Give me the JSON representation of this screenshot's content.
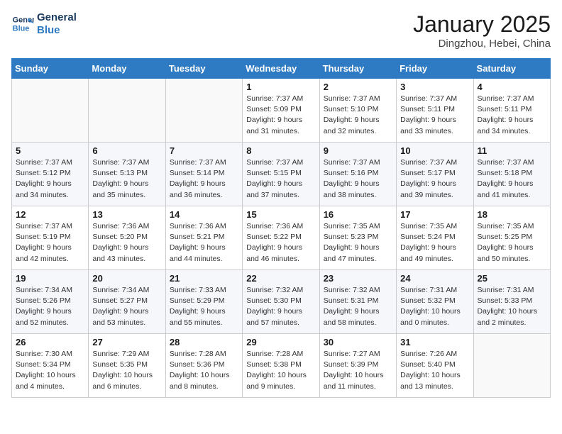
{
  "logo": {
    "line1": "General",
    "line2": "Blue"
  },
  "title": "January 2025",
  "location": "Dingzhou, Hebei, China",
  "weekdays": [
    "Sunday",
    "Monday",
    "Tuesday",
    "Wednesday",
    "Thursday",
    "Friday",
    "Saturday"
  ],
  "weeks": [
    [
      {
        "day": "",
        "info": ""
      },
      {
        "day": "",
        "info": ""
      },
      {
        "day": "",
        "info": ""
      },
      {
        "day": "1",
        "info": "Sunrise: 7:37 AM\nSunset: 5:09 PM\nDaylight: 9 hours\nand 31 minutes."
      },
      {
        "day": "2",
        "info": "Sunrise: 7:37 AM\nSunset: 5:10 PM\nDaylight: 9 hours\nand 32 minutes."
      },
      {
        "day": "3",
        "info": "Sunrise: 7:37 AM\nSunset: 5:11 PM\nDaylight: 9 hours\nand 33 minutes."
      },
      {
        "day": "4",
        "info": "Sunrise: 7:37 AM\nSunset: 5:11 PM\nDaylight: 9 hours\nand 34 minutes."
      }
    ],
    [
      {
        "day": "5",
        "info": "Sunrise: 7:37 AM\nSunset: 5:12 PM\nDaylight: 9 hours\nand 34 minutes."
      },
      {
        "day": "6",
        "info": "Sunrise: 7:37 AM\nSunset: 5:13 PM\nDaylight: 9 hours\nand 35 minutes."
      },
      {
        "day": "7",
        "info": "Sunrise: 7:37 AM\nSunset: 5:14 PM\nDaylight: 9 hours\nand 36 minutes."
      },
      {
        "day": "8",
        "info": "Sunrise: 7:37 AM\nSunset: 5:15 PM\nDaylight: 9 hours\nand 37 minutes."
      },
      {
        "day": "9",
        "info": "Sunrise: 7:37 AM\nSunset: 5:16 PM\nDaylight: 9 hours\nand 38 minutes."
      },
      {
        "day": "10",
        "info": "Sunrise: 7:37 AM\nSunset: 5:17 PM\nDaylight: 9 hours\nand 39 minutes."
      },
      {
        "day": "11",
        "info": "Sunrise: 7:37 AM\nSunset: 5:18 PM\nDaylight: 9 hours\nand 41 minutes."
      }
    ],
    [
      {
        "day": "12",
        "info": "Sunrise: 7:37 AM\nSunset: 5:19 PM\nDaylight: 9 hours\nand 42 minutes."
      },
      {
        "day": "13",
        "info": "Sunrise: 7:36 AM\nSunset: 5:20 PM\nDaylight: 9 hours\nand 43 minutes."
      },
      {
        "day": "14",
        "info": "Sunrise: 7:36 AM\nSunset: 5:21 PM\nDaylight: 9 hours\nand 44 minutes."
      },
      {
        "day": "15",
        "info": "Sunrise: 7:36 AM\nSunset: 5:22 PM\nDaylight: 9 hours\nand 46 minutes."
      },
      {
        "day": "16",
        "info": "Sunrise: 7:35 AM\nSunset: 5:23 PM\nDaylight: 9 hours\nand 47 minutes."
      },
      {
        "day": "17",
        "info": "Sunrise: 7:35 AM\nSunset: 5:24 PM\nDaylight: 9 hours\nand 49 minutes."
      },
      {
        "day": "18",
        "info": "Sunrise: 7:35 AM\nSunset: 5:25 PM\nDaylight: 9 hours\nand 50 minutes."
      }
    ],
    [
      {
        "day": "19",
        "info": "Sunrise: 7:34 AM\nSunset: 5:26 PM\nDaylight: 9 hours\nand 52 minutes."
      },
      {
        "day": "20",
        "info": "Sunrise: 7:34 AM\nSunset: 5:27 PM\nDaylight: 9 hours\nand 53 minutes."
      },
      {
        "day": "21",
        "info": "Sunrise: 7:33 AM\nSunset: 5:29 PM\nDaylight: 9 hours\nand 55 minutes."
      },
      {
        "day": "22",
        "info": "Sunrise: 7:32 AM\nSunset: 5:30 PM\nDaylight: 9 hours\nand 57 minutes."
      },
      {
        "day": "23",
        "info": "Sunrise: 7:32 AM\nSunset: 5:31 PM\nDaylight: 9 hours\nand 58 minutes."
      },
      {
        "day": "24",
        "info": "Sunrise: 7:31 AM\nSunset: 5:32 PM\nDaylight: 10 hours\nand 0 minutes."
      },
      {
        "day": "25",
        "info": "Sunrise: 7:31 AM\nSunset: 5:33 PM\nDaylight: 10 hours\nand 2 minutes."
      }
    ],
    [
      {
        "day": "26",
        "info": "Sunrise: 7:30 AM\nSunset: 5:34 PM\nDaylight: 10 hours\nand 4 minutes."
      },
      {
        "day": "27",
        "info": "Sunrise: 7:29 AM\nSunset: 5:35 PM\nDaylight: 10 hours\nand 6 minutes."
      },
      {
        "day": "28",
        "info": "Sunrise: 7:28 AM\nSunset: 5:36 PM\nDaylight: 10 hours\nand 8 minutes."
      },
      {
        "day": "29",
        "info": "Sunrise: 7:28 AM\nSunset: 5:38 PM\nDaylight: 10 hours\nand 9 minutes."
      },
      {
        "day": "30",
        "info": "Sunrise: 7:27 AM\nSunset: 5:39 PM\nDaylight: 10 hours\nand 11 minutes."
      },
      {
        "day": "31",
        "info": "Sunrise: 7:26 AM\nSunset: 5:40 PM\nDaylight: 10 hours\nand 13 minutes."
      },
      {
        "day": "",
        "info": ""
      }
    ]
  ]
}
